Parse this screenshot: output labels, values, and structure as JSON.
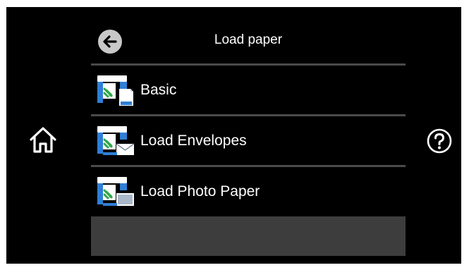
{
  "header": {
    "title": "Load paper",
    "back_icon": "arrow-left-icon"
  },
  "menu": {
    "items": [
      {
        "label": "Basic",
        "icon": "paper-load-basic-icon"
      },
      {
        "label": "Load Envelopes",
        "icon": "paper-load-envelope-icon"
      },
      {
        "label": "Load Photo Paper",
        "icon": "paper-load-photo-icon"
      }
    ]
  },
  "nav": {
    "home_icon": "home-icon",
    "help_icon": "help-icon"
  },
  "colors": {
    "background": "#000000",
    "text": "#ffffff",
    "divider": "#4a4a4a",
    "icon_blue": "#2f7fd6",
    "icon_green": "#2fa84a",
    "bottom_bar": "#3d3d3d"
  }
}
